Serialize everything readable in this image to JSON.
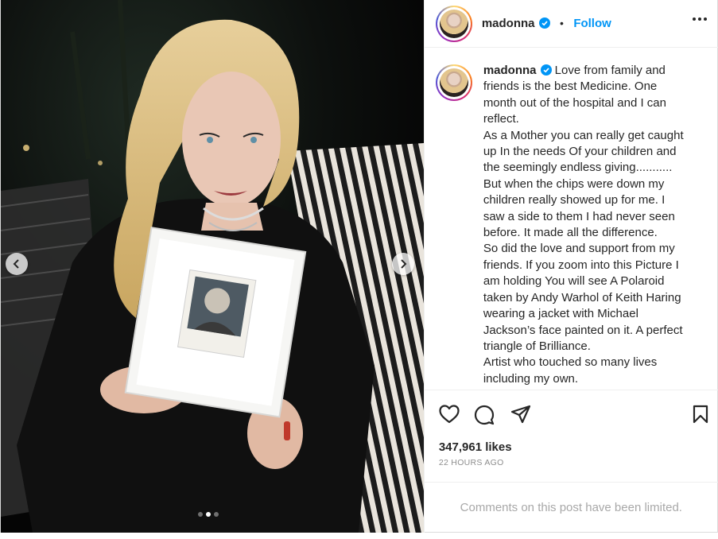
{
  "post": {
    "username": "madonna",
    "follow_label": "Follow",
    "separator": "•",
    "caption_lines": [
      "Love from family and",
      "friends is the best Medicine. One",
      "month out of the hospital and I can",
      "reflect.",
      "As a Mother you can really get caught",
      "up In the needs Of your children and",
      "the seemingly endless giving...........",
      "But when the chips were down my",
      "children really showed up for me. I",
      "saw a side to them I had never seen",
      "before. It made all the difference.",
      "So did the love and support from my",
      "friends. If you zoom into this Picture I",
      "am holding You will see A Polaroid",
      "taken by Andy Warhol of Keith Haring",
      "wearing a jacket with Michael",
      "Jackson’s face painted on it. A perfect",
      "triangle of Brilliance.",
      "Artist who touched so many lives",
      "including my own."
    ],
    "likes": "347,961 likes",
    "timestamp": "22 HOURS AGO",
    "comments_notice": "Comments on this post have been limited."
  },
  "carousel": {
    "slide_count": 3,
    "active_index": 1
  },
  "icons": {
    "like": "heart-icon",
    "comment": "comment-icon",
    "share": "send-icon",
    "save": "bookmark-icon",
    "verified": "verified-badge-icon",
    "more": "more-options-icon",
    "prev": "chevron-left-icon",
    "next": "chevron-right-icon"
  },
  "colors": {
    "link_blue": "#0095f6",
    "verified_blue": "#0095f6",
    "muted": "#8e8e8e",
    "text": "#262626"
  }
}
